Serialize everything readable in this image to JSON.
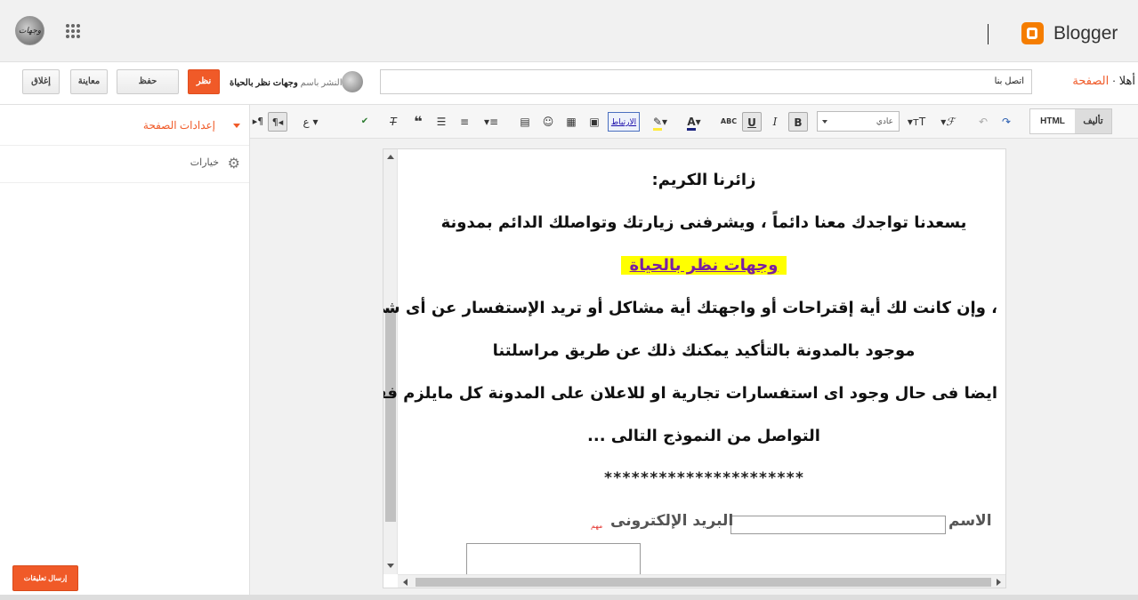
{
  "header": {
    "brand": "Blogger",
    "avatar_text": "وجهات",
    "colors": {
      "accent": "#f05a28",
      "brand": "#f57d00"
    }
  },
  "actionbar": {
    "close_label": "إغلاق",
    "preview_label": "معاينة",
    "save_label": "حفظ",
    "view_label": "نظر",
    "publish_prefix": "النشر باسم",
    "publish_blog": "وجهات نظر بالحياة",
    "page_title_value": "اتصل بنا",
    "breadcrumb_greeting": "أهلا ·",
    "breadcrumb_link": "الصفحة"
  },
  "sidebar": {
    "settings_label": "إعدادات الصفحة",
    "options_label": "خيارات",
    "feedback_label": "إرسال تعليقات"
  },
  "toolbar": {
    "mode_compose": "تأليف",
    "mode_html": "HTML",
    "font_size_value": "عادي",
    "link_label": "الارتباط",
    "icons": [
      "redo-icon",
      "undo-icon",
      "font-family-icon",
      "font-size-icon",
      "bold-icon",
      "italic-icon",
      "underline-icon",
      "strikethrough-icon",
      "text-color-icon",
      "highlight-icon",
      "link-icon",
      "image-icon",
      "video-icon",
      "emoji-icon",
      "jump-break-icon",
      "align-icon",
      "numbered-list-icon",
      "bulleted-list-icon",
      "quote-icon",
      "clear-format-icon",
      "spellcheck-icon",
      "input-tools-icon",
      "rtl-icon",
      "ltr-icon"
    ]
  },
  "document": {
    "lines": [
      "زائرنا الكريم:",
      "يسعدنا تواجدك معنا دائماً ، ويشرفنى زيارتك وتواصلك الدائم بمدونة",
      "وجهات نظر بالحياة",
      "، وإن كانت لك أية إقتراحات أو واجهتك أية مشاكل أو تريد الإستفسار عن أى شئٍ",
      "موجود بالمدونة بالتأكيد يمكنك ذلك عن طريق مراسلتنا",
      "ايضا فى حال وجود اى استفسارات تجارية او للاعلان على المدونة كل مايلزم فقط",
      "التواصل من النموذج التالى ..."
    ],
    "stars": "**********************",
    "form": {
      "name_label": "الاسم",
      "email_label": "البريد الإلكترونى",
      "required_label": "مهم"
    }
  }
}
